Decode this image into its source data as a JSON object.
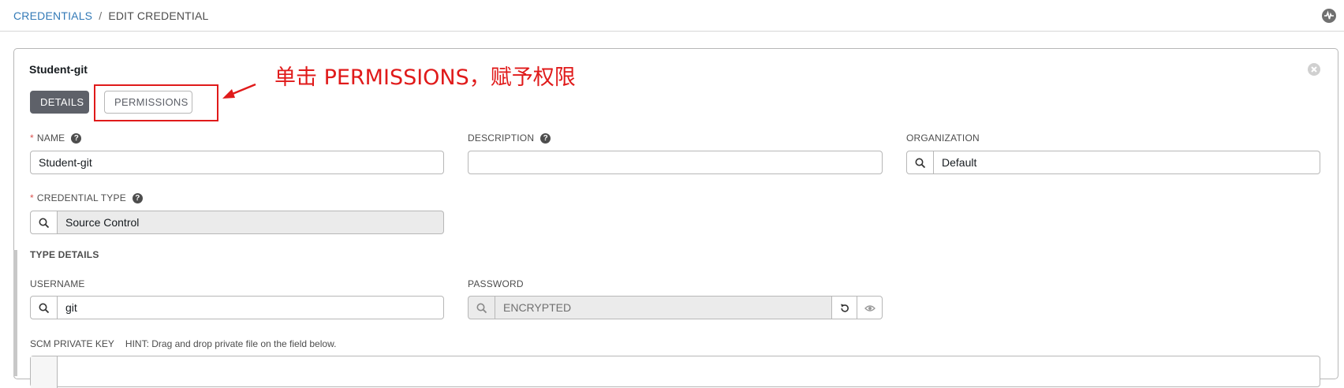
{
  "breadcrumb": {
    "parent": "CREDENTIALS",
    "separator": "/",
    "current": "EDIT CREDENTIAL"
  },
  "panel": {
    "title": "Student-git"
  },
  "tabs": [
    {
      "label": "DETAILS",
      "active": true
    },
    {
      "label": "PERMISSIONS",
      "active": false
    }
  ],
  "annotation": {
    "text": "单击 PERMISSIONS，赋予权限",
    "color": "#e01a1a"
  },
  "fields": {
    "name": {
      "label": "NAME",
      "required": true,
      "value": "Student-git"
    },
    "description": {
      "label": "DESCRIPTION",
      "value": ""
    },
    "organization": {
      "label": "ORGANIZATION",
      "value": "Default"
    },
    "credential_type": {
      "label": "CREDENTIAL TYPE",
      "required": true,
      "value": "Source Control"
    },
    "username": {
      "label": "USERNAME",
      "value": "git"
    },
    "password": {
      "label": "PASSWORD",
      "value": "ENCRYPTED"
    },
    "scm_private_key": {
      "label": "SCM PRIVATE KEY",
      "hint": "HINT: Drag and drop private file on the field below."
    }
  },
  "sections": {
    "type_details": "TYPE DETAILS"
  },
  "required_marker": "*",
  "help_glyph": "?",
  "icons": [
    "activity-stream-icon",
    "close-icon",
    "search-icon",
    "revert-icon",
    "eye-icon",
    "help-icon"
  ],
  "colors": {
    "link": "#337ab7",
    "active_tab": "#5e6169",
    "required": "#d9534f",
    "annotation": "#e01a1a"
  }
}
